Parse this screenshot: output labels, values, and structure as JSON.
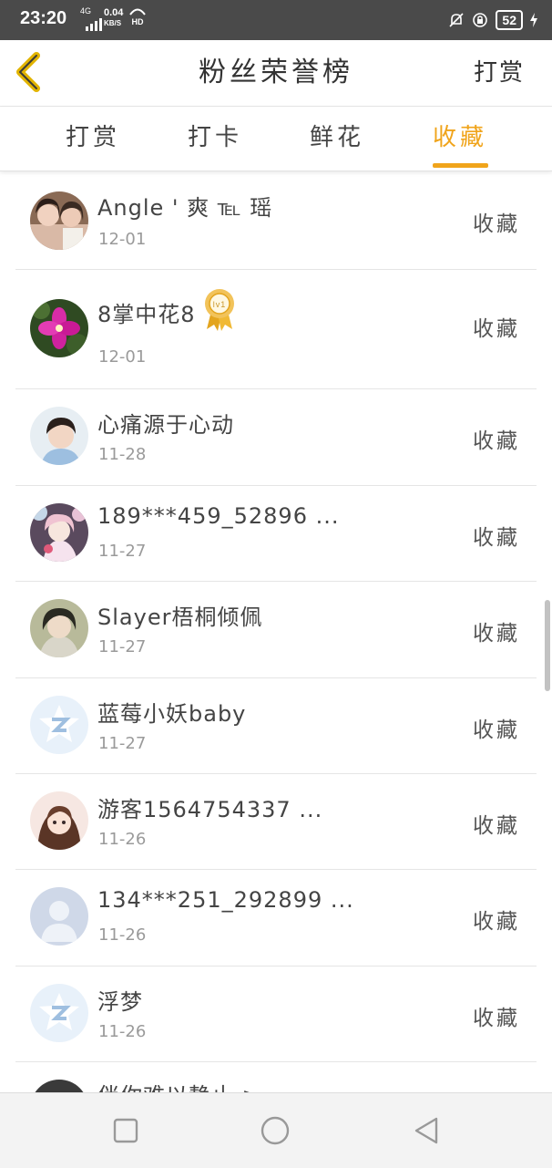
{
  "status_bar": {
    "time": "23:20",
    "network": "4G",
    "speed_value": "0.04",
    "speed_unit": "KB/S",
    "hd_label": "HD",
    "battery": "52"
  },
  "header": {
    "title": "粉丝荣誉榜",
    "right_button": "打赏"
  },
  "tabs": [
    {
      "label": "打赏",
      "active": false
    },
    {
      "label": "打卡",
      "active": false
    },
    {
      "label": "鲜花",
      "active": false
    },
    {
      "label": "收藏",
      "active": true
    }
  ],
  "accent_color": "#f0a41b",
  "rows": [
    {
      "name": "Angle ' 爽 ℡ 瑶",
      "date": "12-01",
      "action": "收藏",
      "avatar": "photo-two-girls"
    },
    {
      "name": "8掌中花8",
      "date": "12-01",
      "action": "收藏",
      "avatar": "pink-flower",
      "badge": "lv1",
      "badge_icon": "rosette-badge-icon"
    },
    {
      "name": "心痛源于心动",
      "date": "11-28",
      "action": "收藏",
      "avatar": "photo-boy"
    },
    {
      "name": "189***459_52896 ...",
      "date": "11-27",
      "action": "收藏",
      "avatar": "anime-girl"
    },
    {
      "name": "Slayer梧桐倾佩",
      "date": "11-27",
      "action": "收藏",
      "avatar": "photo-person"
    },
    {
      "name": "蓝莓小妖baby",
      "date": "11-27",
      "action": "收藏",
      "avatar": "default-qq"
    },
    {
      "name": "游客1564754337 ...",
      "date": "11-26",
      "action": "收藏",
      "avatar": "cartoon-girl"
    },
    {
      "name": "134***251_292899 ...",
      "date": "11-26",
      "action": "收藏",
      "avatar": "default-person"
    },
    {
      "name": "浮梦",
      "date": "11-26",
      "action": "收藏",
      "avatar": "default-qq"
    },
    {
      "name": "伴你难以静止 >",
      "date": "",
      "action": "",
      "avatar": "photo-dark"
    }
  ]
}
